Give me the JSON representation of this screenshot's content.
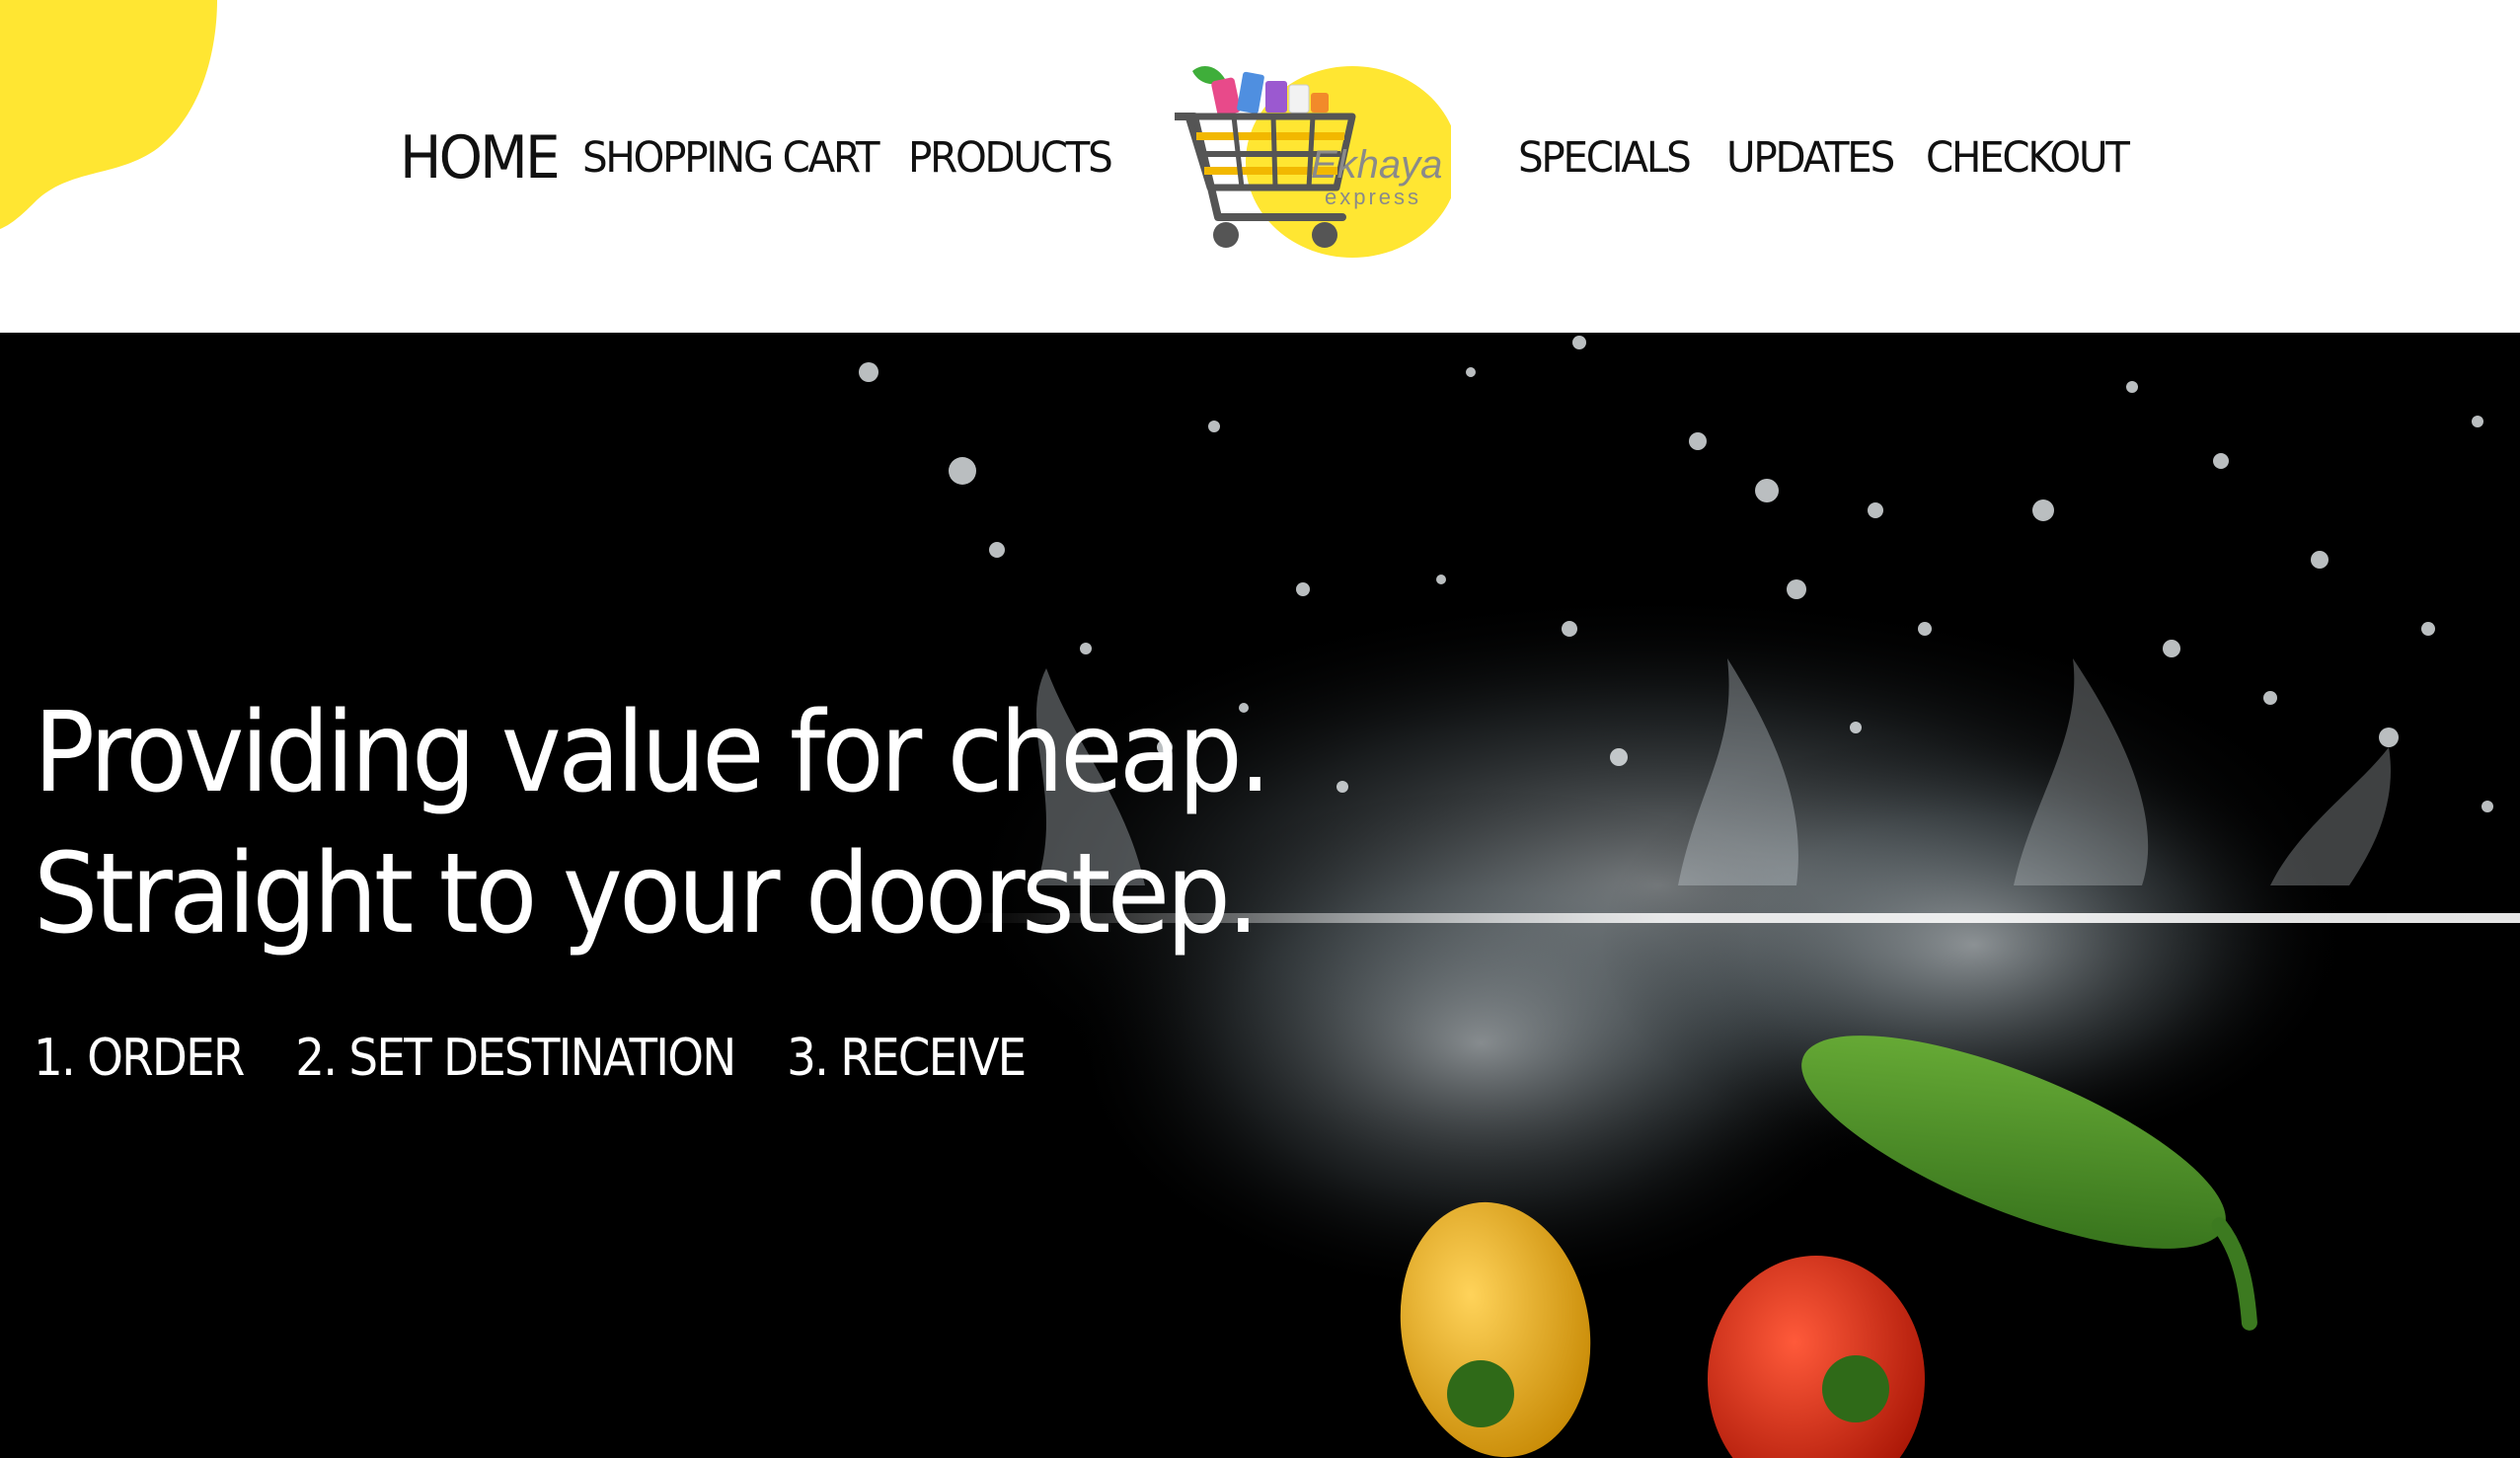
{
  "header": {
    "nav_left": [
      {
        "label": "HOME",
        "active": true
      },
      {
        "label": "SHOPPING CART",
        "active": false
      },
      {
        "label": "PRODUCTS",
        "active": false
      }
    ],
    "nav_right": [
      {
        "label": "SPECIALS",
        "active": false
      },
      {
        "label": "UPDATES",
        "active": false
      },
      {
        "label": "CHECKOUT",
        "active": false
      }
    ],
    "logo": {
      "name": "Ekhaya",
      "tagline": "express",
      "icon": "shopping-cart-icon"
    }
  },
  "hero": {
    "headline_line1": "Providing value for cheap.",
    "headline_line2": "Straight to your doorstep.",
    "steps": [
      "1. ORDER",
      "2. SET DESTINATION",
      "3. RECEIVE"
    ],
    "image": "vegetables-water-splash"
  },
  "colors": {
    "brand_yellow": "#FFE632",
    "cart_gray": "#5a5a5a",
    "hero_background": "#000000",
    "text_dark": "#111111",
    "text_light": "#ffffff"
  }
}
